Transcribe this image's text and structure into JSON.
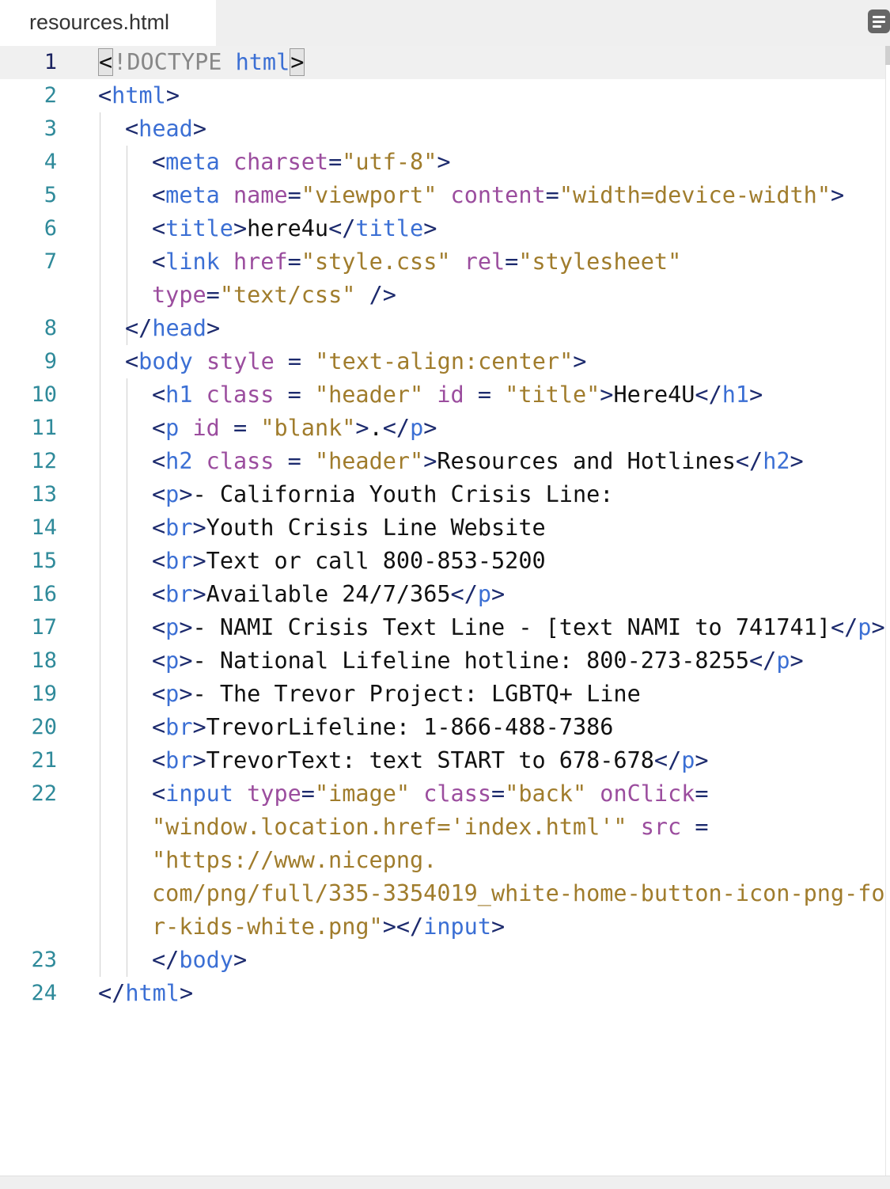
{
  "tab": {
    "filename": "resources.html"
  },
  "toolbar": {
    "menu_icon": "hamburger-menu-icon"
  },
  "editor": {
    "active_line": 1,
    "lines": [
      {
        "num": "1",
        "tokens": [
          [
            "bm",
            "<"
          ],
          [
            "d",
            "!DOCTYPE "
          ],
          [
            "t",
            "html"
          ],
          [
            "bm",
            ">"
          ]
        ]
      },
      {
        "num": "2",
        "tokens": [
          [
            "p",
            "<"
          ],
          [
            "t",
            "html"
          ],
          [
            "p",
            ">"
          ]
        ]
      },
      {
        "num": "3",
        "tokens": [
          [
            "p",
            "<"
          ],
          [
            "t",
            "head"
          ],
          [
            "p",
            ">"
          ]
        ]
      },
      {
        "num": "4",
        "tokens": [
          [
            "p",
            "<"
          ],
          [
            "t",
            "meta "
          ],
          [
            "a",
            "charset"
          ],
          [
            "p",
            "="
          ],
          [
            "v",
            "\"utf-8\""
          ],
          [
            "p",
            ">"
          ]
        ]
      },
      {
        "num": "5",
        "tokens": [
          [
            "p",
            "<"
          ],
          [
            "t",
            "meta "
          ],
          [
            "a",
            "name"
          ],
          [
            "p",
            "="
          ],
          [
            "v",
            "\"viewport\" "
          ],
          [
            "a",
            "content"
          ],
          [
            "p",
            "="
          ],
          [
            "v",
            "\"width=device-width\""
          ],
          [
            "p",
            ">"
          ]
        ]
      },
      {
        "num": "6",
        "tokens": [
          [
            "p",
            "<"
          ],
          [
            "t",
            "title"
          ],
          [
            "p",
            ">"
          ],
          [
            "",
            "here4u"
          ],
          [
            "p",
            "</"
          ],
          [
            "t",
            "title"
          ],
          [
            "p",
            ">"
          ]
        ]
      },
      {
        "num": "7",
        "tokens": [
          [
            "p",
            "<"
          ],
          [
            "t",
            "link "
          ],
          [
            "a",
            "href"
          ],
          [
            "p",
            "="
          ],
          [
            "v",
            "\"style.css\" "
          ],
          [
            "a",
            "rel"
          ],
          [
            "p",
            "="
          ],
          [
            "v",
            "\"stylesheet\""
          ]
        ]
      },
      {
        "num": "",
        "tokens": [
          [
            "a",
            "type"
          ],
          [
            "p",
            "="
          ],
          [
            "v",
            "\"text/css\" "
          ],
          [
            "p",
            "/>"
          ]
        ]
      },
      {
        "num": "8",
        "tokens": [
          [
            "p",
            "</"
          ],
          [
            "t",
            "head"
          ],
          [
            "p",
            ">"
          ]
        ]
      },
      {
        "num": "9",
        "tokens": [
          [
            "p",
            "<"
          ],
          [
            "t",
            "body "
          ],
          [
            "a",
            "style "
          ],
          [
            "p",
            "= "
          ],
          [
            "v",
            "\"text-align:center\""
          ],
          [
            "p",
            ">"
          ]
        ]
      },
      {
        "num": "10",
        "tokens": [
          [
            "p",
            "<"
          ],
          [
            "t",
            "h1 "
          ],
          [
            "a",
            "class "
          ],
          [
            "p",
            "= "
          ],
          [
            "v",
            "\"header\" "
          ],
          [
            "a",
            "id "
          ],
          [
            "p",
            "= "
          ],
          [
            "v",
            "\"title\""
          ],
          [
            "p",
            ">"
          ],
          [
            "",
            "Here4U"
          ],
          [
            "p",
            "</"
          ],
          [
            "t",
            "h1"
          ],
          [
            "p",
            ">"
          ]
        ]
      },
      {
        "num": "11",
        "tokens": [
          [
            "p",
            "<"
          ],
          [
            "t",
            "p "
          ],
          [
            "a",
            "id "
          ],
          [
            "p",
            "= "
          ],
          [
            "v",
            "\"blank\""
          ],
          [
            "p",
            ">"
          ],
          [
            "",
            "."
          ],
          [
            "p",
            "</"
          ],
          [
            "t",
            "p"
          ],
          [
            "p",
            ">"
          ]
        ]
      },
      {
        "num": "12",
        "tokens": [
          [
            "p",
            "<"
          ],
          [
            "t",
            "h2 "
          ],
          [
            "a",
            "class "
          ],
          [
            "p",
            "= "
          ],
          [
            "v",
            "\"header\""
          ],
          [
            "p",
            ">"
          ],
          [
            "",
            "Resources and Hotlines"
          ],
          [
            "p",
            "</"
          ],
          [
            "t",
            "h2"
          ],
          [
            "p",
            ">"
          ]
        ]
      },
      {
        "num": "13",
        "tokens": [
          [
            "p",
            "<"
          ],
          [
            "t",
            "p"
          ],
          [
            "p",
            ">"
          ],
          [
            "",
            "- California Youth Crisis Line:"
          ]
        ]
      },
      {
        "num": "14",
        "tokens": [
          [
            "p",
            "<"
          ],
          [
            "t",
            "br"
          ],
          [
            "p",
            ">"
          ],
          [
            "",
            "Youth Crisis Line Website"
          ]
        ]
      },
      {
        "num": "15",
        "tokens": [
          [
            "p",
            "<"
          ],
          [
            "t",
            "br"
          ],
          [
            "p",
            ">"
          ],
          [
            "",
            "Text or call 800-853-5200"
          ]
        ]
      },
      {
        "num": "16",
        "tokens": [
          [
            "p",
            "<"
          ],
          [
            "t",
            "br"
          ],
          [
            "p",
            ">"
          ],
          [
            "",
            "Available 24/7/365"
          ],
          [
            "p",
            "</"
          ],
          [
            "t",
            "p"
          ],
          [
            "p",
            ">"
          ]
        ]
      },
      {
        "num": "17",
        "tokens": [
          [
            "p",
            "<"
          ],
          [
            "t",
            "p"
          ],
          [
            "p",
            ">"
          ],
          [
            "",
            "- NAMI Crisis Text Line - [text NAMI to 741741]"
          ],
          [
            "p",
            "</"
          ],
          [
            "t",
            "p"
          ],
          [
            "p",
            ">"
          ]
        ]
      },
      {
        "num": "18",
        "tokens": [
          [
            "p",
            "<"
          ],
          [
            "t",
            "p"
          ],
          [
            "p",
            ">"
          ],
          [
            "",
            "- National Lifeline hotline: 800-273-8255"
          ],
          [
            "p",
            "</"
          ],
          [
            "t",
            "p"
          ],
          [
            "p",
            ">"
          ]
        ]
      },
      {
        "num": "19",
        "tokens": [
          [
            "p",
            "<"
          ],
          [
            "t",
            "p"
          ],
          [
            "p",
            ">"
          ],
          [
            "",
            "- The Trevor Project: LGBTQ+ Line"
          ]
        ]
      },
      {
        "num": "20",
        "tokens": [
          [
            "p",
            "<"
          ],
          [
            "t",
            "br"
          ],
          [
            "p",
            ">"
          ],
          [
            "",
            "TrevorLifeline: 1-866-488-7386"
          ]
        ]
      },
      {
        "num": "21",
        "tokens": [
          [
            "p",
            "<"
          ],
          [
            "t",
            "br"
          ],
          [
            "p",
            ">"
          ],
          [
            "",
            "TrevorText: text START to 678-678"
          ],
          [
            "p",
            "</"
          ],
          [
            "t",
            "p"
          ],
          [
            "p",
            ">"
          ]
        ]
      },
      {
        "num": "22",
        "tokens": [
          [
            "p",
            "<"
          ],
          [
            "t",
            "input "
          ],
          [
            "a",
            "type"
          ],
          [
            "p",
            "="
          ],
          [
            "v",
            "\"image\" "
          ],
          [
            "a",
            "class"
          ],
          [
            "p",
            "="
          ],
          [
            "v",
            "\"back\" "
          ],
          [
            "a",
            "onClick"
          ],
          [
            "p",
            "="
          ]
        ]
      },
      {
        "num": "",
        "tokens": [
          [
            "v",
            "\"window.location.href='index.html'\" "
          ],
          [
            "a",
            "src "
          ],
          [
            "p",
            "="
          ]
        ]
      },
      {
        "num": "",
        "tokens": [
          [
            "v",
            "\"https://www.nicepng."
          ]
        ]
      },
      {
        "num": "",
        "tokens": [
          [
            "v",
            "com/png/full/335-3354019_white-home-button-icon-png-fo"
          ]
        ]
      },
      {
        "num": "",
        "tokens": [
          [
            "v",
            "r-kids-white.png\""
          ],
          [
            "p",
            "></"
          ],
          [
            "t",
            "input"
          ],
          [
            "p",
            ">"
          ]
        ]
      },
      {
        "num": "23",
        "tokens": [
          [
            "p",
            "</"
          ],
          [
            "t",
            "body"
          ],
          [
            "p",
            ">"
          ]
        ]
      },
      {
        "num": "24",
        "tokens": [
          [
            "p",
            "</"
          ],
          [
            "t",
            "html"
          ],
          [
            "p",
            ">"
          ]
        ]
      }
    ]
  }
}
